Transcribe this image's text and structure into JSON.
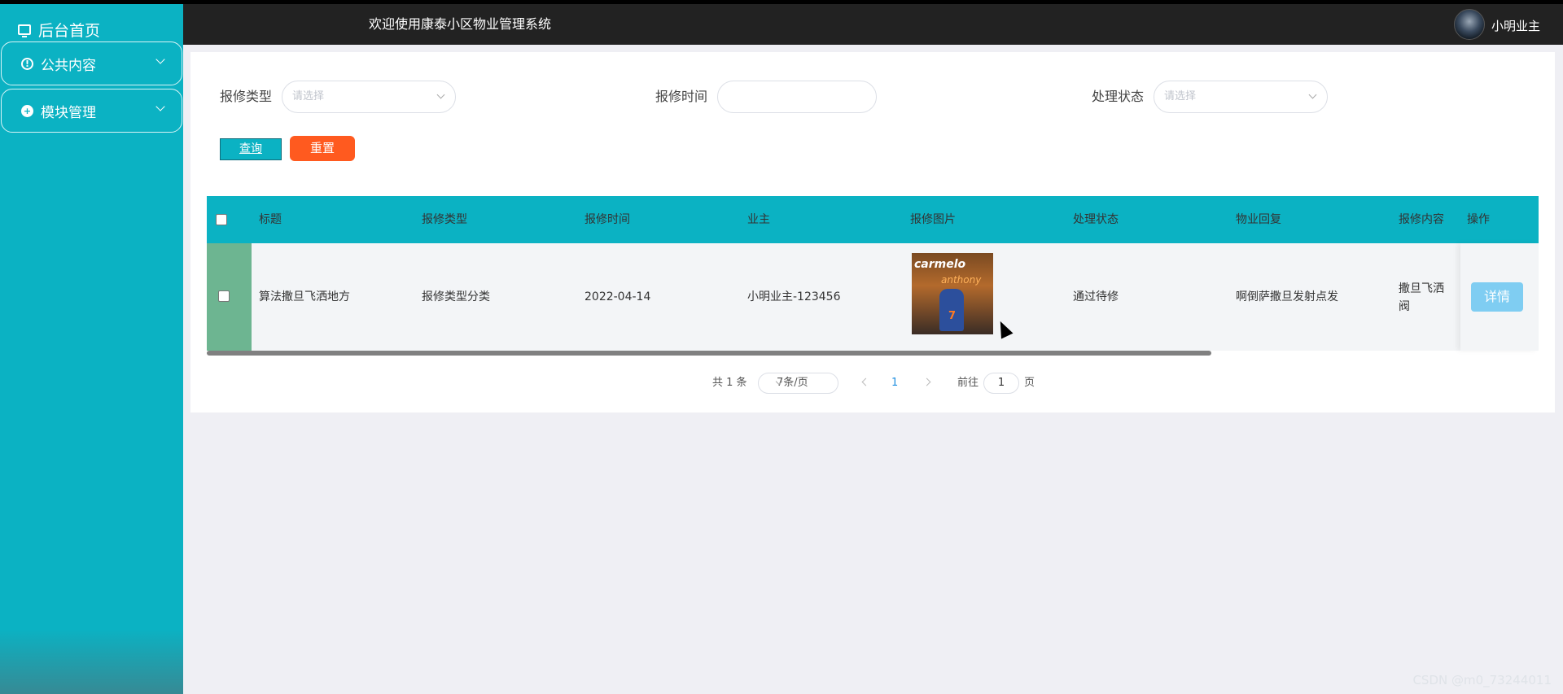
{
  "sidebar": {
    "home_label": "后台首页",
    "menus": [
      {
        "label": "公共内容",
        "icon": "info-icon"
      },
      {
        "label": "模块管理",
        "icon": "plus-circle-icon"
      }
    ]
  },
  "header": {
    "welcome": "欢迎使用康泰小区物业管理系统",
    "username": "小明业主"
  },
  "filters": {
    "type_label": "报修类型",
    "type_placeholder": "请选择",
    "time_label": "报修时间",
    "status_label": "处理状态",
    "status_placeholder": "请选择",
    "query_label": "查询",
    "reset_label": "重置"
  },
  "table": {
    "columns": [
      "标题",
      "报修类型",
      "报修时间",
      "业主",
      "报修图片",
      "处理状态",
      "物业回复",
      "报修内容",
      "操作"
    ],
    "rows": [
      {
        "title": "算法撒旦飞洒地方",
        "type": "报修类型分类",
        "time": "2022-04-14",
        "owner": "小明业主-123456",
        "image_brand": "carmelo",
        "image_sub": "anthony",
        "image_number": "7",
        "status": "通过待修",
        "reply": "啊倒萨撒旦发射点发",
        "content_line1": "撒旦飞洒",
        "content_line2": "阀",
        "action_label": "详情"
      }
    ]
  },
  "pagination": {
    "total": "共 1 条",
    "page_size": "7条/页",
    "current_page": "1",
    "goto_label": "前往",
    "goto_value": "1",
    "page_suffix": "页"
  },
  "watermark": "CSDN @m0_73244011",
  "colors": {
    "sidebar": "#0bb2c3",
    "header": "#222222",
    "reset": "#ff5a1f",
    "detail": "#7fcdf2",
    "row_select": "#6db591"
  }
}
